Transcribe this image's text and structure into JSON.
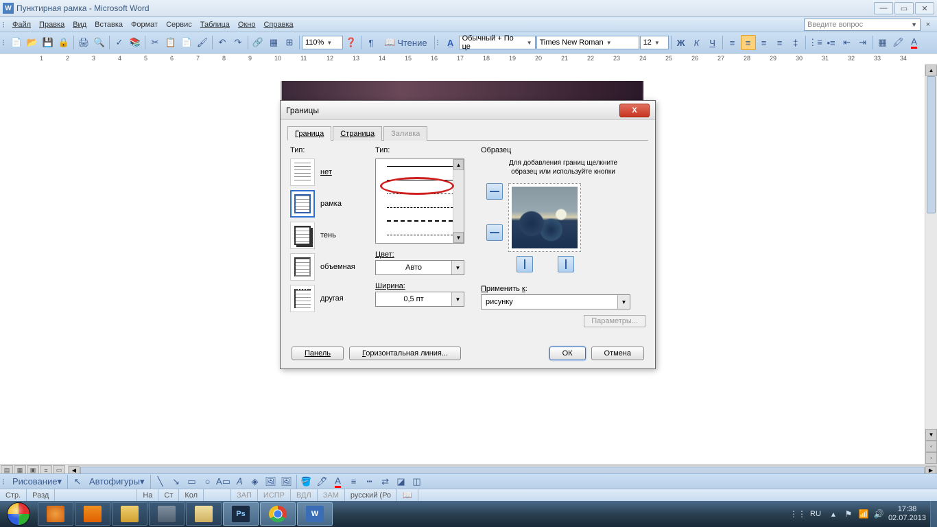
{
  "window": {
    "title": "Пунктирная рамка - Microsoft Word"
  },
  "menu": {
    "file": "Файл",
    "edit": "Правка",
    "view": "Вид",
    "insert": "Вставка",
    "format": "Формат",
    "service": "Сервис",
    "table": "Таблица",
    "window": "Окно",
    "help": "Справка",
    "ask_placeholder": "Введите вопрос"
  },
  "toolbar": {
    "zoom": "110%",
    "reading": "Чтение",
    "style": "Обычный + По це",
    "font": "Times New Roman",
    "size": "12"
  },
  "dialog": {
    "title": "Границы",
    "tab_border": "Граница",
    "tab_page": "Страница",
    "tab_fill": "Заливка",
    "label_type": "Тип:",
    "setting_none": "нет",
    "setting_box": "рамка",
    "setting_shadow": "тень",
    "setting_3d": "объемная",
    "setting_custom": "другая",
    "label_style": "Тип:",
    "label_color": "Цвет:",
    "color_value": "Авто",
    "label_width": "Ширина:",
    "width_value": "0,5 пт",
    "label_preview": "Образец",
    "preview_hint1": "Для добавления границ щелкните",
    "preview_hint2": "образец или используйте кнопки",
    "label_apply": "Применить к:",
    "apply_value": "рисунку",
    "btn_params": "Параметры...",
    "btn_panel": "Панель",
    "btn_hline": "Горизонтальная линия...",
    "btn_ok": "ОК",
    "btn_cancel": "Отмена"
  },
  "drawing": {
    "label": "Рисование",
    "autoshapes": "Автофигуры"
  },
  "status": {
    "page": "Стр.",
    "section": "Разд",
    "at": "На",
    "line": "Ст",
    "col": "Кол",
    "rec": "ЗАП",
    "track": "ИСПР",
    "ext": "ВДЛ",
    "ovr": "ЗАМ",
    "lang": "русский (Ро"
  },
  "taskbar": {
    "lang": "RU",
    "time": "17:38",
    "date": "02.07.2013"
  }
}
